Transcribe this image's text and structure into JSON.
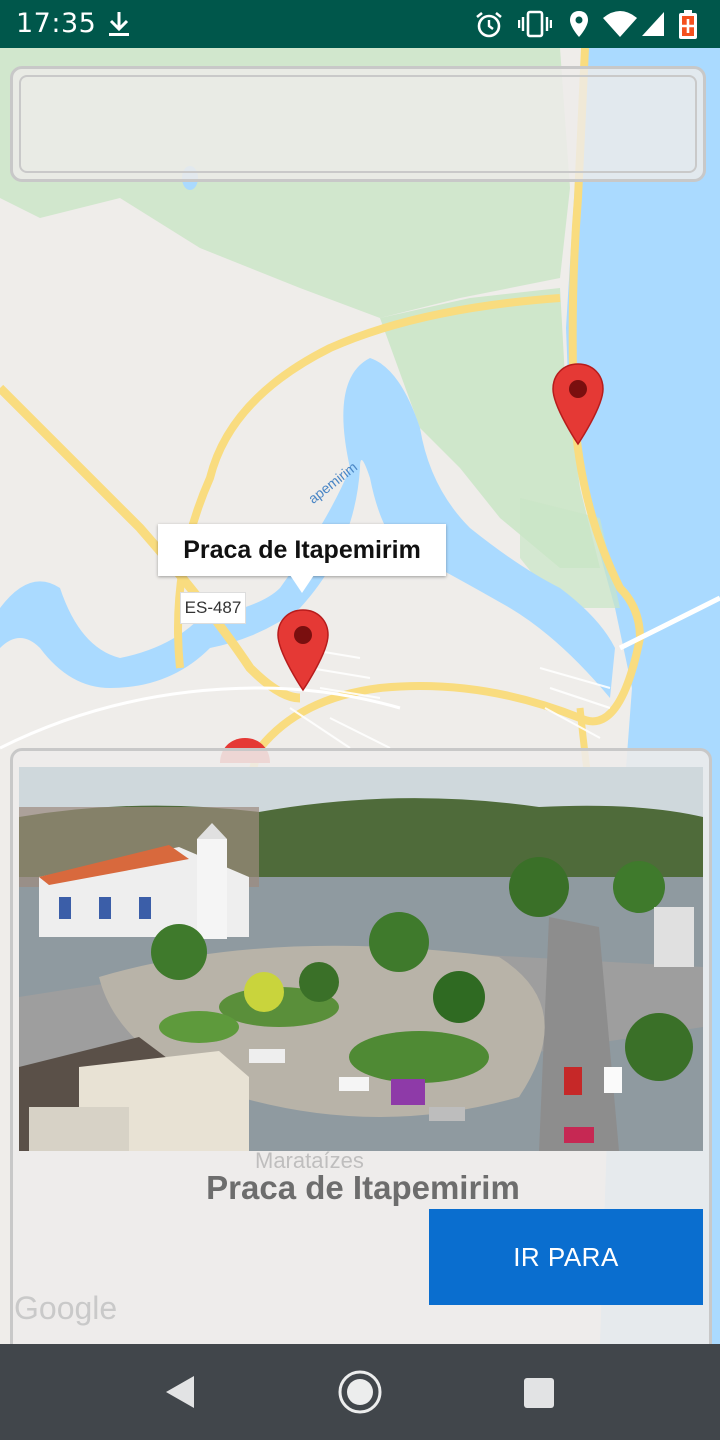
{
  "status_bar": {
    "time": "17:35",
    "icons": [
      "download-icon",
      "alarm-icon",
      "vibrate-icon",
      "location-icon",
      "wifi-icon",
      "signal-icon",
      "battery-charging-icon"
    ]
  },
  "search": {
    "value": "",
    "placeholder": ""
  },
  "map": {
    "info_window_title": "Praca de Itapemirim",
    "route_label": "ES-487",
    "river_label": "apemirim",
    "bottom_label": "Marataízes",
    "attribution": "Google",
    "markers": [
      "marker-praca",
      "marker-beach",
      "marker-partial"
    ]
  },
  "card": {
    "title": "Praca de Itapemirim",
    "button_label": "IR PARA",
    "photo": "aerial-photo-town-square"
  },
  "nav_bar": {
    "buttons": [
      "back-icon",
      "home-icon",
      "recents-icon"
    ]
  },
  "colors": {
    "status_bar": "#00574b",
    "accent_button": "#0a6ecf",
    "marker": "#e53935",
    "nav_bar": "#41464b"
  }
}
